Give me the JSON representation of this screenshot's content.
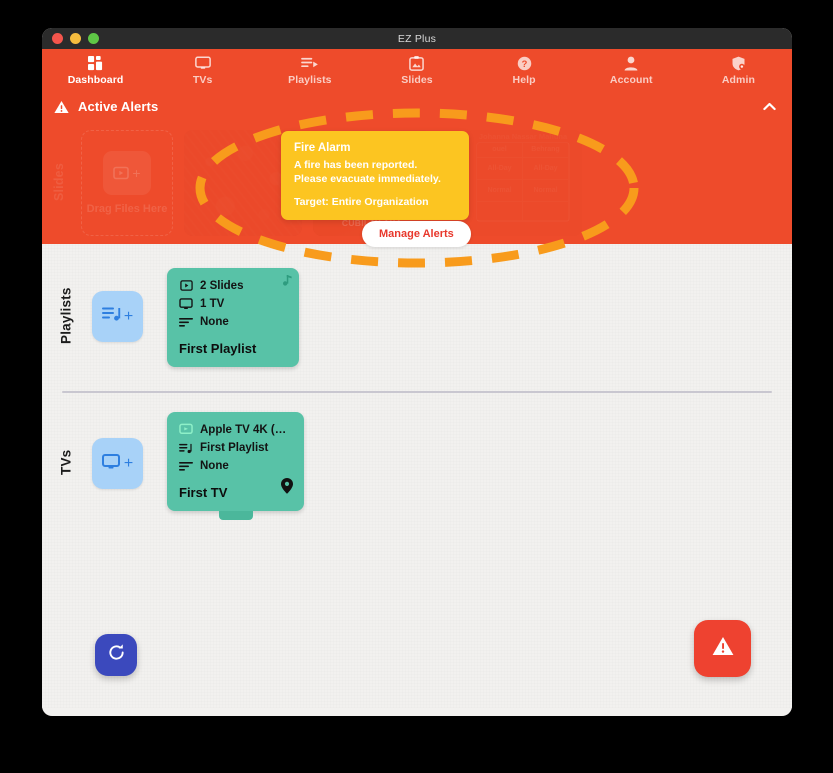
{
  "window": {
    "title": "EZ Plus",
    "traffic_lights": [
      "close",
      "minimize",
      "zoom"
    ]
  },
  "nav": {
    "items": [
      {
        "label": "Dashboard",
        "icon": "dashboard-grid-icon",
        "active": true
      },
      {
        "label": "TVs",
        "icon": "monitor-icon",
        "active": false
      },
      {
        "label": "Playlists",
        "icon": "playlist-icon",
        "active": false
      },
      {
        "label": "Slides",
        "icon": "image-clipboard-icon",
        "active": false
      },
      {
        "label": "Help",
        "icon": "question-circle-icon",
        "active": false
      },
      {
        "label": "Account",
        "icon": "person-icon",
        "active": false
      },
      {
        "label": "Admin",
        "icon": "shield-gear-icon",
        "active": false
      }
    ]
  },
  "alerts": {
    "header_label": "Active Alerts",
    "header_icon": "warning-triangle-icon",
    "collapse_icon": "chevron-up-icon",
    "banner_color": "#ee4b2b",
    "card": {
      "title": "Fire Alarm",
      "line1": "A fire has been reported.",
      "line2": "Please evacuate immediately.",
      "target": "Target: Entire Organization",
      "color": "#fcc521"
    },
    "manage_button": "Manage Alerts",
    "annotation": {
      "shape": "dashed-ellipse",
      "color": "#f89b1c"
    }
  },
  "slides_row": {
    "rail_label": "Slides",
    "dropzone_label": "Drag Files Here",
    "dropzone_icon": "add-slide-icon",
    "thumbs": [
      {
        "caption": ""
      },
      {
        "caption": "AMZENDEKİ CUKUR\nCUBILAY AXA"
      },
      {
        "title": "Johanna Nassar Mahuna",
        "header_left": "ouel",
        "header_right": "Behrang",
        "cells": [
          "All-Day",
          "All-Day",
          "Normal",
          "Normal",
          "",
          ""
        ]
      }
    ]
  },
  "playlists_row": {
    "rail_label": "Playlists",
    "add_icon": "add-playlist-icon",
    "cards": [
      {
        "name": "First Playlist",
        "lines": [
          {
            "icon": "slide-icon",
            "text": "2 Slides"
          },
          {
            "icon": "monitor-icon",
            "text": "1 TV"
          },
          {
            "icon": "list-icon",
            "text": "None"
          }
        ],
        "corner_icon": "music-note-icon",
        "color": "#58c2a7"
      }
    ]
  },
  "tvs_row": {
    "rail_label": "TVs",
    "add_icon": "add-tv-icon",
    "cards": [
      {
        "name": "First TV",
        "lines": [
          {
            "icon": "apple-tv-icon",
            "text": "Apple TV 4K (…"
          },
          {
            "icon": "playlist-icon",
            "text": "First Playlist"
          },
          {
            "icon": "list-icon",
            "text": "None"
          }
        ],
        "corner_icon": "location-pin-icon",
        "color": "#58c2a7"
      }
    ]
  },
  "floating_buttons": [
    {
      "name": "refresh",
      "icon": "refresh-icon",
      "color": "#3b49bd"
    },
    {
      "name": "alarm",
      "icon": "warning-triangle-icon",
      "color": "#ee4230"
    }
  ]
}
